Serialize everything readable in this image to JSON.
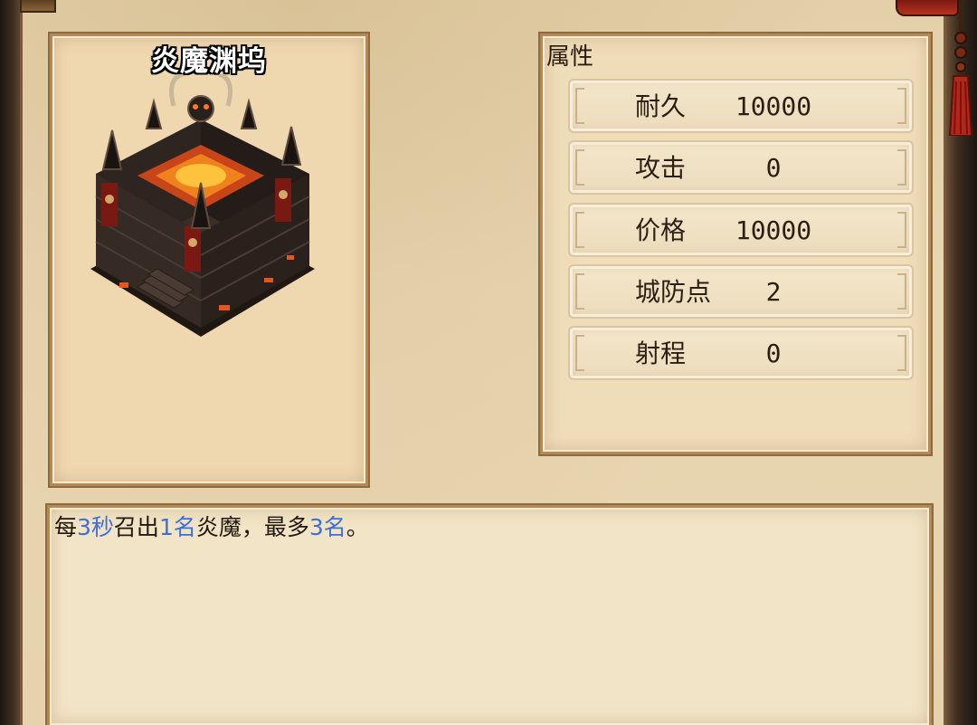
{
  "building": {
    "name": "炎魔渊坞",
    "image_icon": "demon-fortress-icon"
  },
  "attributes": {
    "title": "属性",
    "rows": [
      {
        "label": "耐久",
        "value": "10000"
      },
      {
        "label": "攻击",
        "value": "0"
      },
      {
        "label": "价格",
        "value": "10000"
      },
      {
        "label": "城防点",
        "value": "2"
      },
      {
        "label": "射程",
        "value": "0"
      }
    ]
  },
  "description": {
    "parts": [
      {
        "text": "每",
        "highlight": false
      },
      {
        "text": "3秒",
        "highlight": true
      },
      {
        "text": "召出",
        "highlight": false
      },
      {
        "text": "1名",
        "highlight": true
      },
      {
        "text": "炎魔，最多",
        "highlight": false
      },
      {
        "text": "3名",
        "highlight": true
      },
      {
        "text": "。",
        "highlight": false
      }
    ]
  },
  "colors": {
    "highlight": "#3e6fd8",
    "parchment": "#efdcb8",
    "frame": "#b38a55"
  }
}
